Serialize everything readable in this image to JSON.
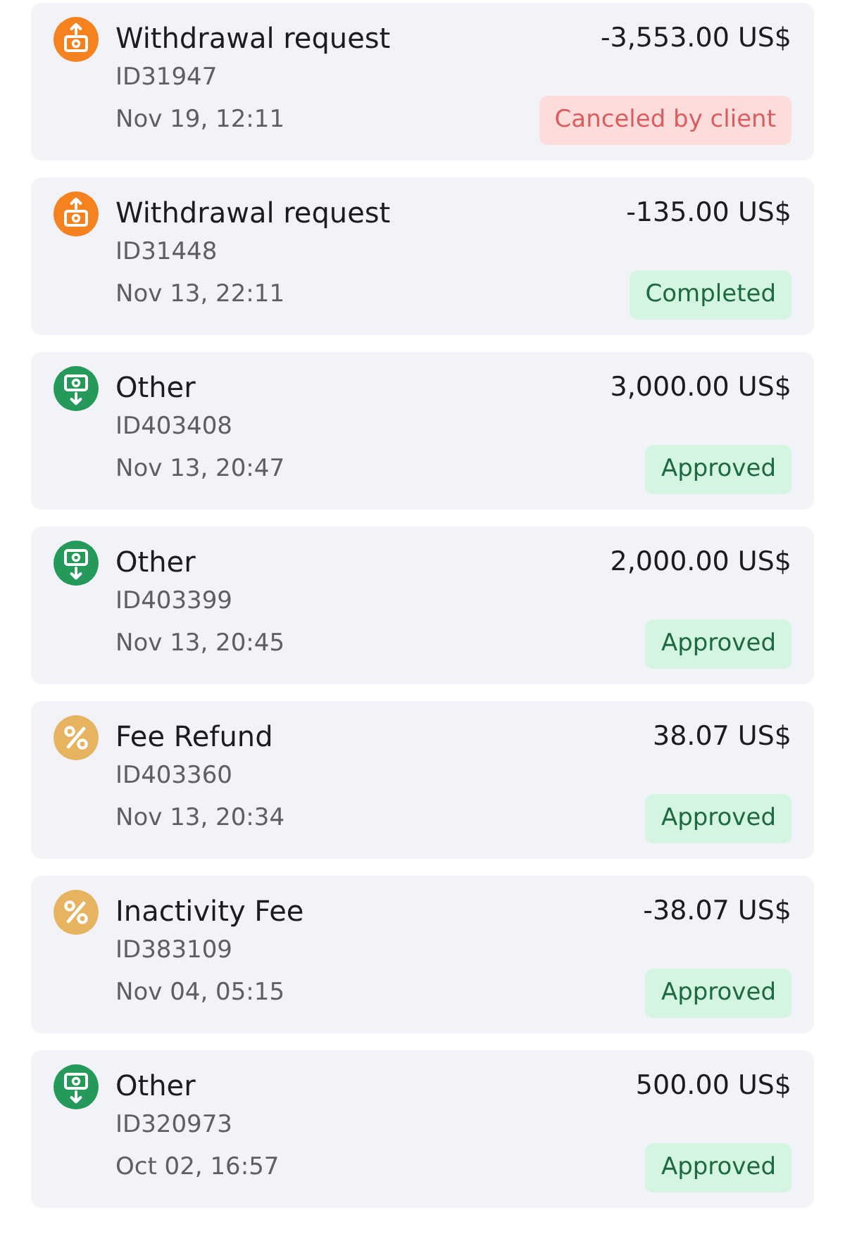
{
  "transactions": [
    {
      "kind": "withdrawal",
      "title": "Withdrawal request",
      "id": "ID31947",
      "date": "Nov 19, 12:11",
      "amount": "-3,553.00 US$",
      "status": {
        "kind": "error",
        "label": "Canceled by client"
      }
    },
    {
      "kind": "withdrawal",
      "title": "Withdrawal request",
      "id": "ID31448",
      "date": "Nov 13, 22:11",
      "amount": "-135.00 US$",
      "status": {
        "kind": "success",
        "label": "Completed"
      }
    },
    {
      "kind": "deposit",
      "title": "Other",
      "id": "ID403408",
      "date": "Nov 13, 20:47",
      "amount": "3,000.00 US$",
      "status": {
        "kind": "success",
        "label": "Approved"
      }
    },
    {
      "kind": "deposit",
      "title": "Other",
      "id": "ID403399",
      "date": "Nov 13, 20:45",
      "amount": "2,000.00 US$",
      "status": {
        "kind": "success",
        "label": "Approved"
      }
    },
    {
      "kind": "fee",
      "title": "Fee Refund",
      "id": "ID403360",
      "date": "Nov 13, 20:34",
      "amount": "38.07 US$",
      "status": {
        "kind": "success",
        "label": "Approved"
      }
    },
    {
      "kind": "fee",
      "title": "Inactivity Fee",
      "id": "ID383109",
      "date": "Nov 04, 05:15",
      "amount": "-38.07 US$",
      "status": {
        "kind": "success",
        "label": "Approved"
      }
    },
    {
      "kind": "deposit",
      "title": "Other",
      "id": "ID320973",
      "date": "Oct 02, 16:57",
      "amount": "500.00 US$",
      "status": {
        "kind": "success",
        "label": "Approved"
      }
    }
  ]
}
